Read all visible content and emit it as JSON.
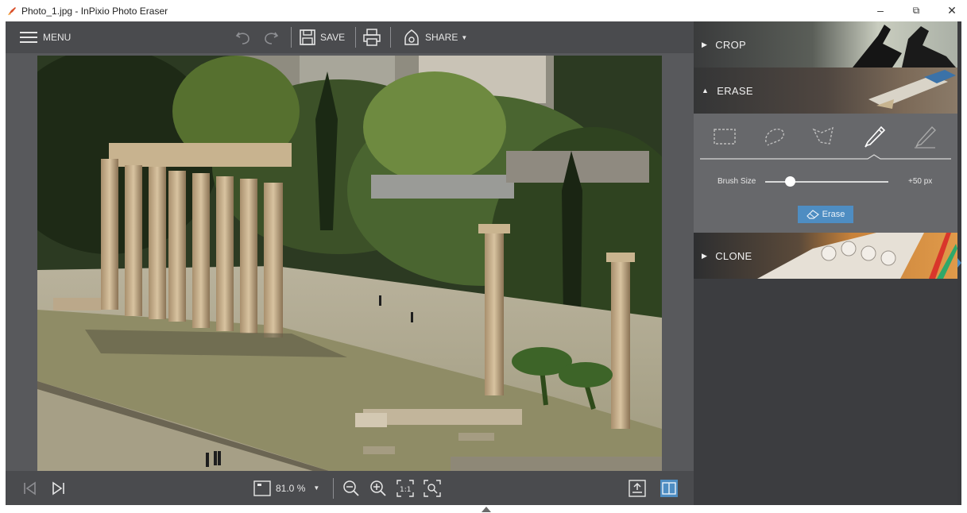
{
  "window": {
    "title": "Photo_1.jpg - InPixio Photo Eraser",
    "minimize_glyph": "–",
    "maximize_glyph": "⧉",
    "close_glyph": "✕"
  },
  "toolbar": {
    "menu_label": "MENU",
    "save_label": "SAVE",
    "share_label": "SHARE"
  },
  "bottombar": {
    "zoom_value": "81.0 %"
  },
  "panel": {
    "crop_label": "CROP",
    "erase_label": "ERASE",
    "clone_label": "CLONE",
    "brush_size_label": "Brush Size",
    "brush_size_value": "+50 px",
    "brush_size_level": 0.2,
    "erase_button_label": "Erase",
    "selected_tool": "brush"
  },
  "colors": {
    "accent": "#4e8dc2",
    "toolbar_bg": "#4a4b4e",
    "panel_bg": "#3c3d40",
    "erase_panel_bg": "#67686b"
  },
  "icons": [
    "app-icon",
    "menu-icon",
    "undo-icon",
    "redo-icon",
    "save-icon",
    "print-icon",
    "share-icon",
    "previous-icon",
    "next-icon",
    "fit-icon",
    "zoom-out-icon",
    "zoom-in-icon",
    "actual-size-icon",
    "zoom-fit-icon",
    "export-icon",
    "compare-icon",
    "rectangle-select-icon",
    "lasso-icon",
    "polygon-lasso-icon",
    "brush-icon",
    "eraser-brush-icon",
    "eraser-icon"
  ]
}
